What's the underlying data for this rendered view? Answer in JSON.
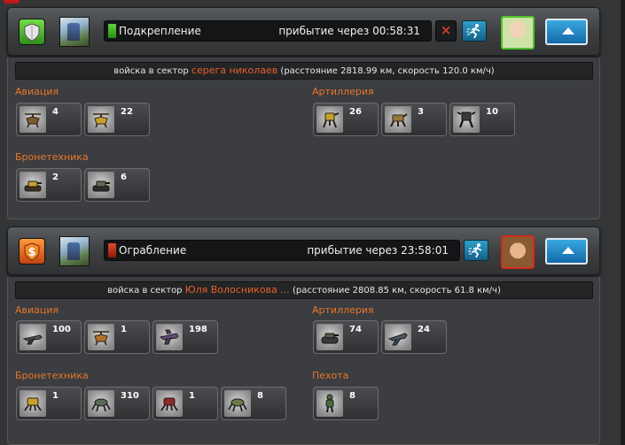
{
  "missions": [
    {
      "type_icon": "shield-icon",
      "type_color": "#4fc22c",
      "name": "Подкрепление",
      "arrival": "прибытие через 00:58:31",
      "cancel_icon": "×",
      "sector_prefix": "войска в сектор",
      "sector_player": "серега николаев",
      "sector_suffix": "(расстояние 2818.99 км, скорость 120.0 км/ч)",
      "categories": [
        {
          "label": "Авиация",
          "units": [
            {
              "icon": "helicopter-icon",
              "count": "4"
            },
            {
              "icon": "helicopter-icon",
              "count": "22"
            }
          ]
        },
        {
          "label": "Бронетехника",
          "units": [
            {
              "icon": "tank-icon",
              "count": "2"
            },
            {
              "icon": "tank-icon",
              "count": "6"
            }
          ]
        },
        {
          "label": "Артиллерия",
          "units": [
            {
              "icon": "mech-icon",
              "count": "26"
            },
            {
              "icon": "mech-icon",
              "count": "3"
            },
            {
              "icon": "mech-icon",
              "count": "10"
            }
          ]
        }
      ]
    },
    {
      "type_icon": "dollar-icon",
      "type_color": "#e8601a",
      "name": "Ограбление",
      "arrival": "прибытие через 23:58:01",
      "sector_prefix": "войска в сектор",
      "sector_player": "Юля Волосникова ...",
      "sector_suffix": "(расстояние 2808.85 км, скорость 61.8 км/ч)",
      "categories": [
        {
          "label": "Авиация",
          "units": [
            {
              "icon": "jet-icon",
              "count": "100"
            },
            {
              "icon": "helicopter-icon",
              "count": "1"
            },
            {
              "icon": "jet-icon",
              "count": "198"
            }
          ]
        },
        {
          "label": "Бронетехника",
          "units": [
            {
              "icon": "mech-icon",
              "count": "1"
            },
            {
              "icon": "walker-icon",
              "count": "310"
            },
            {
              "icon": "mech-icon",
              "count": "1"
            },
            {
              "icon": "walker-icon",
              "count": "8"
            }
          ]
        },
        {
          "label": "Артиллерия",
          "units": [
            {
              "icon": "tank-icon",
              "count": "74"
            },
            {
              "icon": "jet-icon",
              "count": "24"
            }
          ]
        },
        {
          "label": "Пехота",
          "units": [
            {
              "icon": "soldier-icon",
              "count": "8"
            }
          ]
        }
      ]
    }
  ]
}
